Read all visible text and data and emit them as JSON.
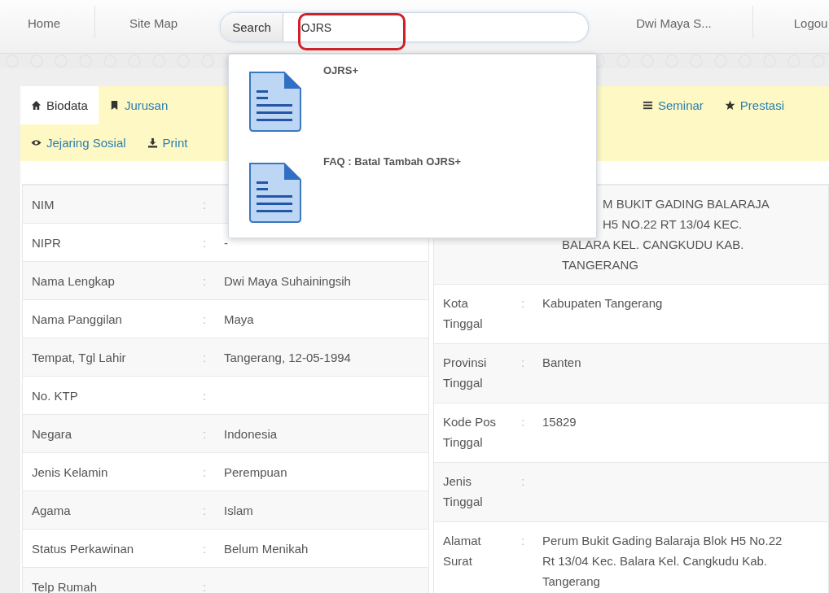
{
  "nav": {
    "links": [
      {
        "label": "Home"
      },
      {
        "label": "Site Map"
      }
    ],
    "search": {
      "button": "Search",
      "value": "OJRS"
    },
    "user": "Dwi Maya S...",
    "logout": "Logou"
  },
  "tab_rows": [
    [
      {
        "label": "Biodata",
        "selected": true
      },
      {
        "label": "Jurusan",
        "selected": false
      },
      {
        "label": "Seminar",
        "selected": false
      },
      {
        "label": "Prestasi",
        "selected": false
      }
    ],
    [
      {
        "label": "Jejaring Sosial",
        "selected": false
      },
      {
        "label": "Print",
        "selected": false
      }
    ]
  ],
  "left_table": [
    {
      "label": "NIM",
      "sep": ":"
    },
    {
      "label": "NIPR",
      "sep": ":",
      "value": "-"
    },
    {
      "label": "Nama Lengkap",
      "sep": ":",
      "value": "Dwi Maya Suhainingsih"
    },
    {
      "label": "Nama Panggilan",
      "sep": ":",
      "value": "Maya"
    },
    {
      "label": "Tempat, Tgl Lahir",
      "sep": ":",
      "value": "Tangerang, 12-05-1994"
    },
    {
      "label": "No. KTP",
      "sep": ":"
    },
    {
      "label": "Negara",
      "sep": ":",
      "value": "Indonesia"
    },
    {
      "label": "Jenis Kelamin",
      "sep": ":",
      "value": "Perempuan"
    },
    {
      "label": "Agama",
      "sep": ":",
      "value": "Islam"
    },
    {
      "label": "Status Perkawinan",
      "sep": ":",
      "value": "Belum Menikah"
    },
    {
      "label": "Telp Rumah",
      "sep": ":"
    }
  ],
  "right_table": [
    {
      "value_lines": [
        "M BUKIT GADING BALARAJA",
        "H5 NO.22 RT 13/04 KEC.",
        "BALARA KEL. CANGKUDU KAB.",
        "TANGERANG"
      ]
    },
    {
      "label": "Kota Tinggal",
      "sep": ":",
      "value": "Kabupaten Tangerang"
    },
    {
      "label": "Provinsi Tinggal",
      "sep": ":",
      "value": "Banten"
    },
    {
      "label": "Kode Pos Tinggal",
      "sep": ":",
      "value": "15829"
    },
    {
      "label": "Jenis Tinggal",
      "sep": ":"
    },
    {
      "label": "Alamat Surat",
      "sep": ":",
      "value": "Perum Bukit Gading Balaraja Blok H5 No.22 Rt 13/04 Kec. Balara Kel. Cangkudu Kab. Tangerang"
    }
  ],
  "search_results": [
    {
      "title": "OJRS+"
    },
    {
      "title": "FAQ : Batal Tambah OJRS+"
    }
  ]
}
